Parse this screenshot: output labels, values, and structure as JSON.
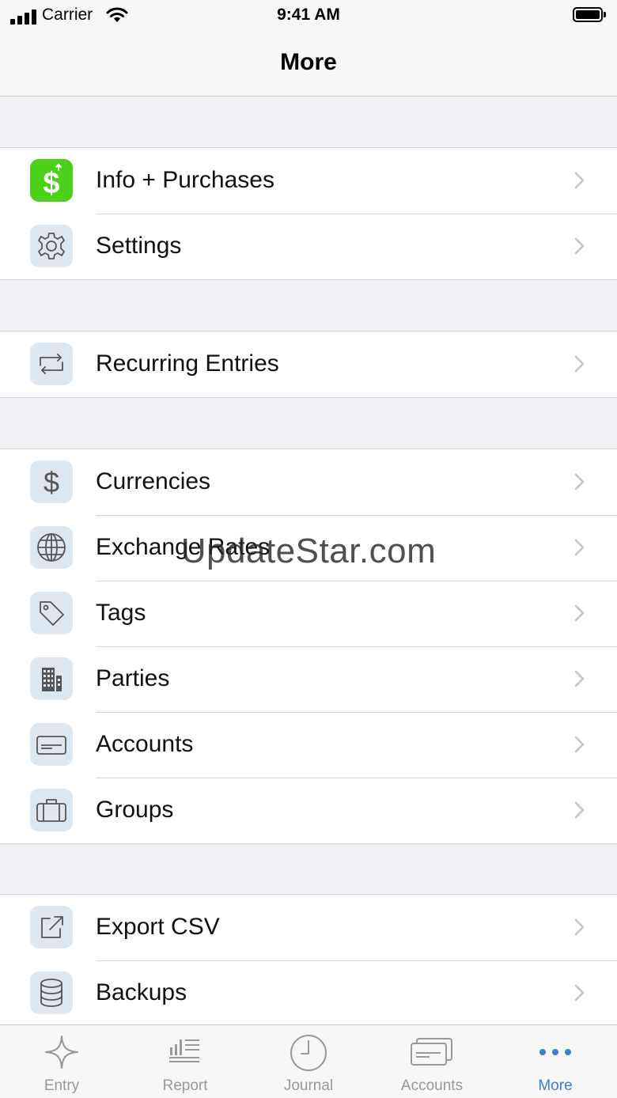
{
  "status_bar": {
    "carrier": "Carrier",
    "time": "9:41 AM"
  },
  "navbar": {
    "title": "More"
  },
  "sections": [
    [
      {
        "label": "Info + Purchases",
        "icon": "dollar-sign-icon"
      },
      {
        "label": "Settings",
        "icon": "gear-icon"
      }
    ],
    [
      {
        "label": "Recurring Entries",
        "icon": "repeat-icon"
      }
    ],
    [
      {
        "label": "Currencies",
        "icon": "currency-dollar-icon"
      },
      {
        "label": "Exchange Rates",
        "icon": "globe-icon"
      },
      {
        "label": "Tags",
        "icon": "tag-icon"
      },
      {
        "label": "Parties",
        "icon": "buildings-icon"
      },
      {
        "label": "Accounts",
        "icon": "card-icon"
      },
      {
        "label": "Groups",
        "icon": "briefcase-icon"
      }
    ],
    [
      {
        "label": "Export CSV",
        "icon": "export-icon"
      },
      {
        "label": "Backups",
        "icon": "database-icon"
      }
    ]
  ],
  "watermark": "UpdateStar.com",
  "tabbar": {
    "tabs": [
      {
        "label": "Entry",
        "icon": "plus-sparkle-icon"
      },
      {
        "label": "Report",
        "icon": "bar-chart-icon"
      },
      {
        "label": "Journal",
        "icon": "clock-icon"
      },
      {
        "label": "Accounts",
        "icon": "cards-icon"
      },
      {
        "label": "More",
        "icon": "ellipsis-icon"
      }
    ],
    "active": "More"
  },
  "colors": {
    "accent": "#3a7fd0",
    "green_icon": "#4cd019",
    "icon_bg": "#dde7f0",
    "inactive_tab": "#999999"
  }
}
